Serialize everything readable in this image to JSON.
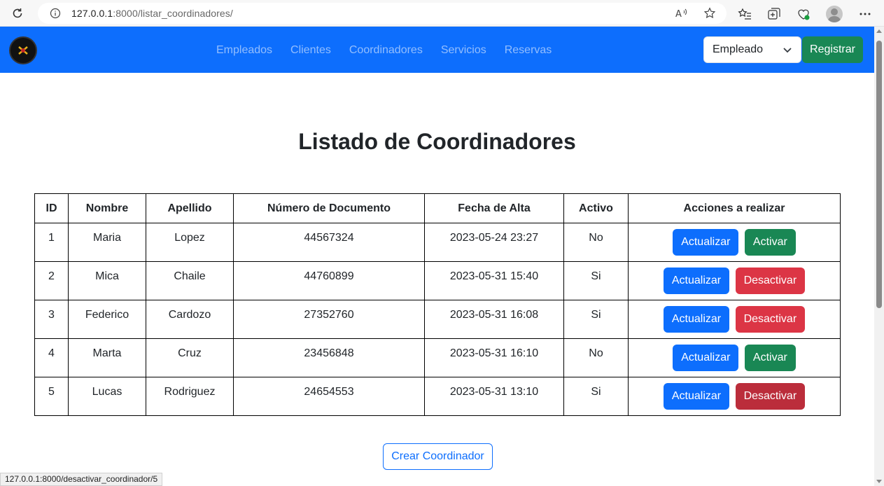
{
  "browser": {
    "url_host": "127.0.0.1",
    "url_rest": ":8000/listar_coordinadores/"
  },
  "navbar": {
    "links": [
      "Empleados",
      "Clientes",
      "Coordinadores",
      "Servicios",
      "Reservas"
    ],
    "select_value": "Empleado",
    "register_label": "Registrar",
    "colors": {
      "bar": "#0d6efd",
      "register": "#198754"
    }
  },
  "main": {
    "title": "Listado de Coordinadores",
    "table": {
      "headers": [
        "ID",
        "Nombre",
        "Apellido",
        "Número de Documento",
        "Fecha de Alta",
        "Activo",
        "Acciones a realizar"
      ],
      "rows": [
        {
          "id": "1",
          "nombre": "Maria",
          "apellido": "Lopez",
          "documento": "44567324",
          "fecha": "2023-05-24 23:27",
          "activo": "No",
          "update_label": "Actualizar",
          "toggle_label": "Activar"
        },
        {
          "id": "2",
          "nombre": "Mica",
          "apellido": "Chaile",
          "documento": "44760899",
          "fecha": "2023-05-31 15:40",
          "activo": "Si",
          "update_label": "Actualizar",
          "toggle_label": "Desactivar"
        },
        {
          "id": "3",
          "nombre": "Federico",
          "apellido": "Cardozo",
          "documento": "27352760",
          "fecha": "2023-05-31 16:08",
          "activo": "Si",
          "update_label": "Actualizar",
          "toggle_label": "Desactivar"
        },
        {
          "id": "4",
          "nombre": "Marta",
          "apellido": "Cruz",
          "documento": "23456848",
          "fecha": "2023-05-31 16:10",
          "activo": "No",
          "update_label": "Actualizar",
          "toggle_label": "Activar"
        },
        {
          "id": "5",
          "nombre": "Lucas",
          "apellido": "Rodriguez",
          "documento": "24654553",
          "fecha": "2023-05-31 13:10",
          "activo": "Si",
          "update_label": "Actualizar",
          "toggle_label": "Desactivar"
        }
      ]
    },
    "create_label": "Crear Coordinador"
  },
  "status_bar": {
    "text": "127.0.0.1:8000/desactivar_coordinador/5"
  }
}
